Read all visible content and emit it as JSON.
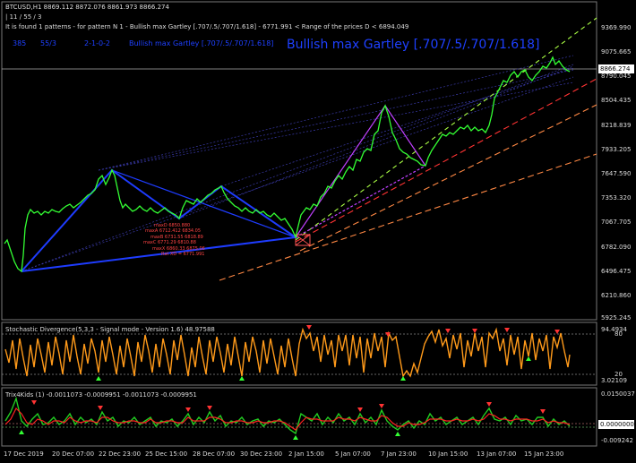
{
  "header": {
    "title_line": "BTCUSD,H1  8869.112 8872.076 8861.973 8866.274",
    "sub_line": "| 11 / 55 / 3",
    "pattern_line": "It is found 1 patterns  -  for pattern N 1 - Bullish max Gartley [.707/.5/.707/1.618] - 6771.991 < Range of the prices D < 6894.049"
  },
  "pattern_info": {
    "a": "385",
    "b": "55/3",
    "c": "2-1-0-2",
    "d": "Bullish max Gartley [.707/.5/.707/1.618]",
    "big_label": "Bullish max Gartley [.707/.5/.707/1.618]"
  },
  "price_axis": {
    "ticks": [
      "9369.990",
      "9075.665",
      "8790.045",
      "8504.435",
      "8218.839",
      "7933.205",
      "7647.590",
      "7353.320",
      "7067.705",
      "6782.090",
      "6496.475",
      "6210.860",
      "5925.245"
    ],
    "current_price": "8866.274"
  },
  "stochastic": {
    "label": "Stochastic Divergence(5,3,3 - Signal mode - Version 1.6) 48.97588",
    "ticks": [
      "94.4934",
      "80",
      "20",
      "3.02109"
    ]
  },
  "trix": {
    "label": "Trix4Kids (1) -0.0011073 -0.0009951 -0.0011073 -0.0009951",
    "ticks": [
      "0.0150037",
      "0.0000000",
      "-0.009242"
    ]
  },
  "time_axis": [
    "17 Dec 2019",
    "20 Dec 07:00",
    "22 Dec 23:00",
    "25 Dec 15:00",
    "28 Dec 07:00",
    "30 Dec 23:00",
    "2 Jan 15:00",
    "5 Jan 07:00",
    "7 Jan 23:00",
    "10 Jan 15:00",
    "13 Jan 07:00",
    "15 Jan 23:00"
  ],
  "colors": {
    "price_line": "#33ff33",
    "pattern": "#1e3cff",
    "stoch": "#ff9a1a",
    "trix_green": "#22cc22",
    "trix_red": "#ff2222"
  }
}
